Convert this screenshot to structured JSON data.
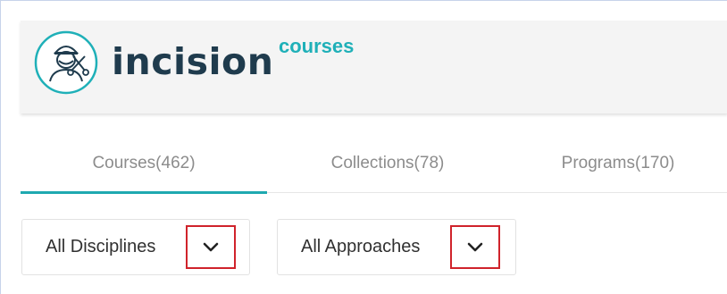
{
  "colors": {
    "brand_dark": "#1f3b4d",
    "brand_accent": "#1fb0b8",
    "tab_active_underline": "#1fa9b0",
    "highlight_box": "#d0232b"
  },
  "header": {
    "logo_icon": "surgeon-with-scissors-icon",
    "brand_name": "incision",
    "brand_sub": "courses"
  },
  "tabs": [
    {
      "label": "Courses(462)",
      "active": true
    },
    {
      "label": "Collections(78)",
      "active": false
    },
    {
      "label": "Programs(170)",
      "active": false
    }
  ],
  "filters": {
    "disciplines": {
      "selected": "All Disciplines",
      "icon": "chevron-down-icon"
    },
    "approaches": {
      "selected": "All Approaches",
      "icon": "chevron-down-icon"
    }
  }
}
